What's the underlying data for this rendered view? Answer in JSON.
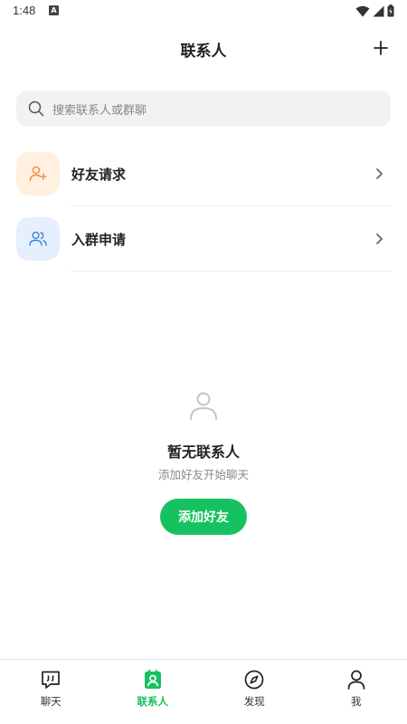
{
  "status_bar": {
    "time": "1:48",
    "notification_letter": "A"
  },
  "header": {
    "title": "联系人",
    "add_icon": "plus-icon"
  },
  "search": {
    "placeholder": "搜索联系人或群聊",
    "icon": "search-icon"
  },
  "entries": [
    {
      "label": "好友请求",
      "icon": "user-plus-icon",
      "color": "#f08a3c"
    },
    {
      "label": "入群申请",
      "icon": "users-icon",
      "color": "#3a7fe0"
    }
  ],
  "empty_state": {
    "icon": "user-outline-icon",
    "title": "暂无联系人",
    "subtitle": "添加好友开始聊天",
    "button_label": "添加好友"
  },
  "tabs": [
    {
      "label": "聊天",
      "icon": "chat-icon",
      "active": false
    },
    {
      "label": "联系人",
      "icon": "contacts-icon",
      "active": true
    },
    {
      "label": "发现",
      "icon": "compass-icon",
      "active": false
    },
    {
      "label": "我",
      "icon": "person-icon",
      "active": false
    }
  ],
  "colors": {
    "accent": "#16c25f",
    "search_bg": "#f2f2f4"
  }
}
